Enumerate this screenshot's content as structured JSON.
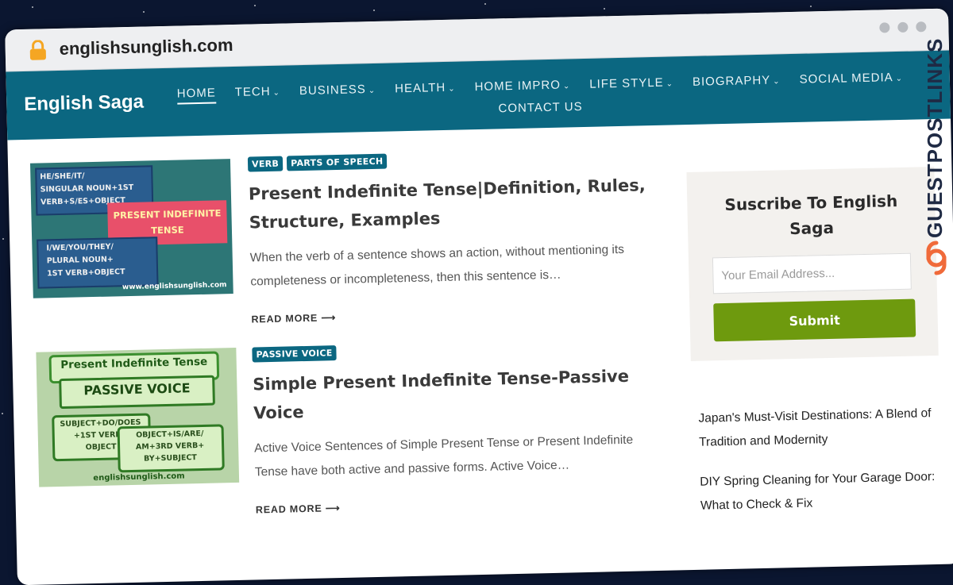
{
  "browser": {
    "url": "englishsunglish.com"
  },
  "site": {
    "logo": "English Saga",
    "nav": [
      {
        "label": "HOME",
        "active": true,
        "dropdown": false
      },
      {
        "label": "TECH",
        "active": false,
        "dropdown": true
      },
      {
        "label": "BUSINESS",
        "active": false,
        "dropdown": true
      },
      {
        "label": "HEALTH",
        "active": false,
        "dropdown": true
      },
      {
        "label": "HOME IMPRO",
        "active": false,
        "dropdown": true
      },
      {
        "label": "LIFE STYLE",
        "active": false,
        "dropdown": true
      },
      {
        "label": "BIOGRAPHY",
        "active": false,
        "dropdown": true
      },
      {
        "label": "SOCIAL MEDIA",
        "active": false,
        "dropdown": true
      },
      {
        "label": "CONTACT US",
        "active": false,
        "dropdown": false
      }
    ]
  },
  "posts": [
    {
      "tags": [
        "VERB",
        "PARTS OF SPEECH"
      ],
      "title": "Present Indefinite Tense|Definition, Rules, Structure, Examples",
      "excerpt": "When the verb of a sentence shows an action, without mentioning its completeness or incompleteness, then this sentence is…",
      "read_more": "READ MORE",
      "thumb": {
        "box1": [
          "HE/SHE/IT/",
          "SINGULAR NOUN+1ST",
          "VERB+S/ES+OBJECT"
        ],
        "center": [
          "PRESENT INDEFINITE",
          "TENSE"
        ],
        "box2": [
          "I/WE/YOU/THEY/",
          "PLURAL NOUN+",
          "1ST VERB+OBJECT"
        ],
        "footer": "www.englishsunglish.com"
      }
    },
    {
      "tags": [
        "PASSIVE VOICE"
      ],
      "title": "Simple Present Indefinite Tense-Passive Voice",
      "excerpt": "Active Voice Sentences of Simple Present Tense or Present Indefinite Tense have both active and passive forms. Active Voice…",
      "read_more": "READ MORE",
      "thumb": {
        "header": "Present Indefinite Tense",
        "banner": "PASSIVE VOICE",
        "box1": [
          "SUBJECT+DO/DOES",
          "+1ST VERB+",
          "OBJECT"
        ],
        "box2": [
          "OBJECT+IS/ARE/",
          "AM+3RD VERB+",
          "BY+SUBJECT"
        ],
        "footer": "englishsunglish.com"
      }
    }
  ],
  "sidebar": {
    "subscribe_title": "Suscribe To English Saga",
    "email_placeholder": "Your Email Address...",
    "submit_label": "Submit",
    "recent": [
      "Japan's Must-Visit Destinations: A Blend of Tradition and Modernity",
      "DIY Spring Cleaning for Your Garage Door: What to Check & Fix"
    ]
  },
  "badge": {
    "text": "GUESTPOSTLINKS"
  },
  "colors": {
    "header_bg": "#0b6781",
    "tag_bg": "#0b6781",
    "submit_bg": "#6e9a0e",
    "badge_icon": "#f06a3a"
  }
}
